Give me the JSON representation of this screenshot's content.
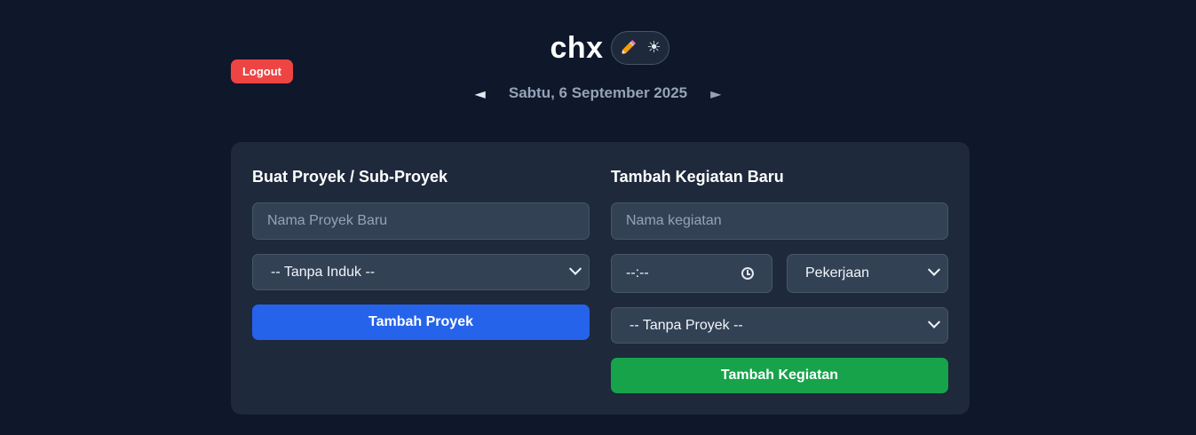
{
  "header": {
    "logout_label": "Logout",
    "app_title": "chx",
    "tools": {
      "pencil_icon": "pencil-icon",
      "sun_icon": "sun-icon",
      "sun_glyph": "☀"
    },
    "prev_arrow": "◄",
    "next_arrow": "►",
    "date": "Sabtu, 6 September 2025"
  },
  "project_form": {
    "title": "Buat Proyek / Sub-Proyek",
    "name_input": {
      "value": "",
      "placeholder": "Nama Proyek Baru"
    },
    "parent_select": {
      "selected": "-- Tanpa Induk --"
    },
    "submit_label": "Tambah Proyek"
  },
  "activity_form": {
    "title": "Tambah Kegiatan Baru",
    "name_input": {
      "value": "",
      "placeholder": "Nama kegiatan"
    },
    "time_input": {
      "display": "--:--"
    },
    "category_select": {
      "selected": "Pekerjaan"
    },
    "project_select": {
      "selected": "-- Tanpa Proyek --"
    },
    "submit_label": "Tambah Kegiatan"
  },
  "colors": {
    "background": "#0f172a",
    "card": "#1e293b",
    "field": "#334155",
    "logout": "#ef4444",
    "primary_blue": "#2563eb",
    "primary_green": "#16a34a",
    "muted_text": "#94a3b8"
  }
}
